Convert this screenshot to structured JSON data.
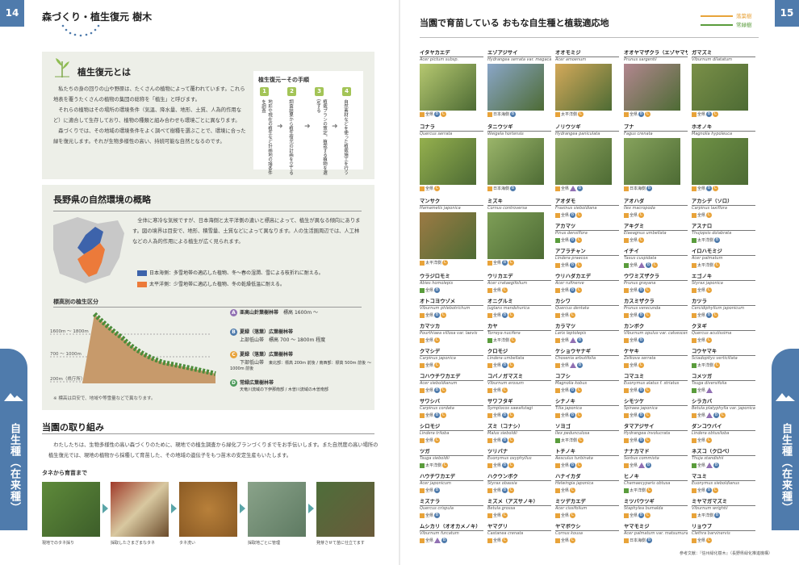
{
  "left": {
    "page_number": "14",
    "header": "森づくり・植生復元 樹木",
    "side_tab": "自生種（在来種）",
    "sec1": {
      "title": "植生復元とは",
      "paragraphs": [
        "私たちの身の回りの山や野原は、たくさんの植物によって覆われています。これら地表を覆うたくさんの植物の集団の総称を「植生」と呼びます。",
        "それらの植物はその場所の環境条件（気温、降水量、地形、土質、人為的作用など）に適合して生存しており、植物の種類と組み合わせも環境ごとに異なります。",
        "森づくりでは、その地域の環境条件をよく調べて樹種を選ぶことで、環境に合った緑を復元します。それが生物多様性の高い、持続可能な自然となるのです。"
      ],
      "steps_title": "植生復元ーその手順",
      "steps": [
        {
          "num": "1",
          "text": "地形や現在の植生など計画地の諸条件を調査"
        },
        {
          "num": "2",
          "text": "調査結果から植生復元の計画を立てる"
        },
        {
          "num": "3",
          "text": "植栽プランの策定。植栽する植物を選定する"
        },
        {
          "num": "4",
          "text": "自然素材などを使った植栽施工を行う"
        }
      ]
    },
    "sec2": {
      "title": "長野県の自然環境の概略",
      "paragraph": "全体に寒冷な気候ですが、日本海側と太平洋側の違いと標高によって、植生が異なる傾向にあります。図の境界は目安で、地形、積雪量、土質などによって異なります。人の生活圏周辺では、人工林などの人為的作用による植生が広く見られます。",
      "legend": [
        {
          "label": "日本海側：多雪地帯の適応した植物、冬〜春の湿潤、雪による枝折れに耐える。",
          "color": "#3d63ab"
        },
        {
          "label": "太平洋側：少雪地帯に適応した植物、冬の乾燥低温に耐える。",
          "color": "#ec7a3a"
        }
      ],
      "elevation_title": "標高別の植生区分",
      "elevations": [
        "1600m 〜 1800m",
        "700 〜 1000m",
        "200m（県庁所）〜 500m（高原部）"
      ],
      "zones": [
        {
          "badge": "A",
          "label": "亜高山針葉樹林帯",
          "note": "標高 1600m 〜",
          "color": "#9170b3"
        },
        {
          "badge": "B",
          "label": "夏緑（落葉）広葉樹林帯",
          "sub": "上部低山帯",
          "note": "標高 700 〜 1800m 程度",
          "color": "#4f7bac"
        },
        {
          "badge": "C",
          "label": "夏緑（落葉）広葉樹林帯",
          "sub": "下部低山帯",
          "note": "東北部：標高 200m 前後 / 南西部：標高 500m 前後",
          "note2": "〜 1000m 前後",
          "color": "#e8a33a"
        },
        {
          "badge": "D",
          "label": "常緑広葉樹林帯",
          "note": "天竜川流域の下伊那南部 / 木曽川流域の木曽南部",
          "color": "#4c9a5b"
        }
      ],
      "footnote": "※ 標高は目安で、地域や等雪量などで異なります。"
    },
    "sec3": {
      "title": "当園の取り組み",
      "paragraph": "わたしたちは、生物多様性の高い森づくりのために、現地での植生調査から緑化プランづくりまでをお手伝いします。また自然度の高い場所の植生復元では、現地の植物から採種して育苗した、その地域の遺伝子をもつ苗木の安定生産もいたします。",
      "photo_title": "タネから育苗まで",
      "photos": [
        "現地でのタネ採り",
        "採取したさまざまなタネ",
        "タネ洗い",
        "採取地ごとに管理",
        "発芽させて苗に仕立てます"
      ]
    }
  },
  "right": {
    "page_number": "15",
    "title": "当園で育苗している おもな自生種と植栽適応地",
    "side_tab": "自生種（在来種）",
    "legend": [
      {
        "label": "落葉樹",
        "color": "#e8a33a"
      },
      {
        "label": "常緑樹",
        "color": "#5a9c3c"
      }
    ],
    "footnote": "参考文献：『信州緑化樹木』（長野県緑化推進機構）",
    "species": [
      {
        "name": "イタヤカエデ",
        "latin": "Acer pictum subsp.",
        "img": "#b6c870",
        "tag": "全県",
        "c": "#e8a33a",
        "i": [
          "B",
          "C"
        ]
      },
      {
        "name": "エゾアジサイ",
        "latin": "Hydrangea serrata var. megacarpa",
        "img": "#8aa6c8",
        "tag": "日本海側",
        "c": "#e8a33a",
        "i": [
          "B"
        ]
      },
      {
        "name": "オオモミジ",
        "latin": "Acer amoenum",
        "img": "#d4a95a",
        "tag": "太平洋側",
        "c": "#e8a33a",
        "i": [
          "C"
        ]
      },
      {
        "name": "オオヤマザクラ（エゾヤマザクラ）",
        "latin": "Prunus sargentii",
        "img": "#b2868f",
        "tag": "全県",
        "c": "#e8a33a",
        "i": [
          "B",
          "C"
        ]
      },
      {
        "name": "ガマズミ",
        "latin": "Viburnum dilatatum",
        "img": "#7a8f48",
        "tag": "全県",
        "c": "#e8a33a",
        "i": [
          "B",
          "C"
        ]
      },
      {
        "name": "コナラ",
        "latin": "Quercus serrata",
        "img": "#95b04e",
        "tag": "全県",
        "c": "#e8a33a",
        "i": [
          "C"
        ]
      },
      {
        "name": "タニウツギ",
        "latin": "Weigela hortensis",
        "img": "#9bb56a",
        "tag": "日本海側",
        "c": "#e8a33a",
        "i": [
          "B"
        ]
      },
      {
        "name": "ノリウツギ",
        "latin": "Hydrangea paniculata",
        "img": "#8ea45e",
        "tag": "全県",
        "c": "#e8a33a",
        "i": [
          "A",
          "B"
        ]
      },
      {
        "name": "ブナ",
        "latin": "Fagus crenata",
        "img": "#86a25c",
        "tag": "日本海側",
        "c": "#e8a33a",
        "i": [
          "B"
        ]
      },
      {
        "name": "ホオノキ",
        "latin": "Magnolia hypoleuca",
        "img": "#6f9145",
        "tag": "全県",
        "c": "#e8a33a",
        "i": [
          "B",
          "C"
        ]
      },
      {
        "name": "マンサク",
        "latin": "Hamamelis japonica",
        "img": "#9c7a44",
        "tag": "太平洋側",
        "c": "#e8a33a",
        "i": [
          "C"
        ]
      },
      {
        "name": "ミズキ",
        "latin": "Cornus controversa",
        "img": "#7e9e57",
        "tag": "全県",
        "c": "#e8a33a",
        "i": [
          "B",
          "C"
        ]
      },
      {
        "name": "アオダモ",
        "latin": "Fraxinus sieboldiana",
        "tag": "全県",
        "c": "#e8a33a",
        "i": [
          "B",
          "C"
        ]
      },
      {
        "name": "アオハダ",
        "latin": "Ilex macropoda",
        "tag": "全県",
        "c": "#e8a33a",
        "i": [
          "C"
        ]
      },
      {
        "name": "アカシデ（ソロ）",
        "latin": "Carpinus laxiflora",
        "tag": "全県",
        "c": "#e8a33a",
        "i": [
          "C"
        ]
      },
      {
        "name": "アカマツ",
        "latin": "Pinus densiflora",
        "tag": "全県",
        "c": "#5a9c3c",
        "i": [
          "B",
          "C"
        ]
      },
      {
        "name": "アキグミ",
        "latin": "Elaeagnus umbellata",
        "tag": "全県",
        "c": "#e8a33a",
        "i": [
          "C"
        ]
      },
      {
        "name": "アスナロ",
        "latin": "Thujopsis dolabrata",
        "tag": "太平洋側",
        "c": "#5a9c3c",
        "i": [
          "B"
        ]
      },
      {
        "name": "アブラチャン",
        "latin": "Lindera praecox",
        "tag": "全県",
        "c": "#e8a33a",
        "i": [
          "B",
          "C"
        ]
      },
      {
        "name": "イチイ",
        "latin": "Taxus cuspidata",
        "tag": "全県",
        "c": "#5a9c3c",
        "i": [
          "A",
          "B",
          "C"
        ]
      },
      {
        "name": "イロハモミジ",
        "latin": "Acer palmatum",
        "tag": "太平洋側",
        "c": "#e8a33a",
        "i": [
          "C"
        ]
      },
      {
        "name": "ウラジロモミ",
        "latin": "Abies homolepis",
        "tag": "全県",
        "c": "#5a9c3c",
        "i": [
          "B"
        ]
      },
      {
        "name": "ウリカエデ",
        "latin": "Acer crataegifolium",
        "tag": "全県",
        "c": "#e8a33a",
        "i": [
          "C"
        ]
      },
      {
        "name": "ウリハダカエデ",
        "latin": "Acer rufinerve",
        "tag": "全県",
        "c": "#e8a33a",
        "i": [
          "B",
          "C"
        ]
      },
      {
        "name": "ウワミズザクラ",
        "latin": "Prunus grayana",
        "tag": "全県",
        "c": "#e8a33a",
        "i": [
          "B",
          "C"
        ]
      },
      {
        "name": "エゴノキ",
        "latin": "Styrax japonica",
        "tag": "全県",
        "c": "#e8a33a",
        "i": [
          "C"
        ]
      },
      {
        "name": "オトコヨウゾメ",
        "latin": "Viburnum phlebotrichum",
        "tag": "全県",
        "c": "#e8a33a",
        "i": [
          "B",
          "C"
        ]
      },
      {
        "name": "オニグルミ",
        "latin": "Juglans mandshurica",
        "tag": "全県",
        "c": "#e8a33a",
        "i": [
          "B",
          "C"
        ]
      },
      {
        "name": "カシワ",
        "latin": "Quercus dentata",
        "tag": "全県",
        "c": "#e8a33a",
        "i": [
          "C"
        ]
      },
      {
        "name": "カスミザクラ",
        "latin": "Prunus verecunda",
        "tag": "全県",
        "c": "#e8a33a",
        "i": [
          "B",
          "C"
        ]
      },
      {
        "name": "カツラ",
        "latin": "Cercidiphyllum japonicum",
        "tag": "全県",
        "c": "#e8a33a",
        "i": [
          "B",
          "C"
        ]
      },
      {
        "name": "カマツカ",
        "latin": "Pourthiaea villosa var. laevis",
        "tag": "全県",
        "c": "#e8a33a",
        "i": [
          "C"
        ]
      },
      {
        "name": "カヤ",
        "latin": "Torreya nucifera",
        "tag": "太平洋側",
        "c": "#5a9c3c",
        "i": [
          "C"
        ]
      },
      {
        "name": "カラマツ",
        "latin": "Larix leptolepis",
        "tag": "全県",
        "c": "#e8a33a",
        "i": [
          "A",
          "B"
        ]
      },
      {
        "name": "カンボク",
        "latin": "Viburnum opulus var. calvescens",
        "tag": "全県",
        "c": "#e8a33a",
        "i": [
          "B"
        ]
      },
      {
        "name": "クヌギ",
        "latin": "Quercus acutissima",
        "tag": "全県",
        "c": "#e8a33a",
        "i": [
          "C"
        ]
      },
      {
        "name": "クマシデ",
        "latin": "Carpinus japonica",
        "tag": "全県",
        "c": "#e8a33a",
        "i": [
          "C"
        ]
      },
      {
        "name": "クロモジ",
        "latin": "Lindera umbellata",
        "tag": "全県",
        "c": "#e8a33a",
        "i": [
          "B",
          "C"
        ]
      },
      {
        "name": "ケショウヤナギ",
        "latin": "Chosenia arbutifolia",
        "tag": "全県",
        "c": "#e8a33a",
        "i": [
          "A",
          "B"
        ]
      },
      {
        "name": "ケヤキ",
        "latin": "Zelkova serrata",
        "tag": "全県",
        "c": "#e8a33a",
        "i": [
          "C"
        ]
      },
      {
        "name": "コウヤマキ",
        "latin": "Sciadopitys verticillata",
        "tag": "太平洋側",
        "c": "#5a9c3c",
        "i": [
          "C"
        ]
      },
      {
        "name": "コハウチワカエデ",
        "latin": "Acer sieboldianum",
        "tag": "全県",
        "c": "#e8a33a",
        "i": [
          "B",
          "C"
        ]
      },
      {
        "name": "コバノガマズミ",
        "latin": "Viburnum erosum",
        "tag": "全県",
        "c": "#e8a33a",
        "i": [
          "C"
        ]
      },
      {
        "name": "コブシ",
        "latin": "Magnolia kobus",
        "tag": "全県",
        "c": "#e8a33a",
        "i": [
          "B",
          "C"
        ]
      },
      {
        "name": "コマユミ",
        "latin": "Euonymus alatus f. striatus",
        "tag": "全県",
        "c": "#e8a33a",
        "i": [
          "B",
          "C"
        ]
      },
      {
        "name": "コメツガ",
        "latin": "Tsuga diversifolia",
        "tag": "全県",
        "c": "#5a9c3c",
        "i": [
          "A"
        ]
      },
      {
        "name": "サワシバ",
        "latin": "Carpinus cordata",
        "tag": "全県",
        "c": "#e8a33a",
        "i": [
          "B",
          "C"
        ]
      },
      {
        "name": "サワフタギ",
        "latin": "Symplocos sawafutagi",
        "tag": "全県",
        "c": "#e8a33a",
        "i": [
          "B",
          "C"
        ]
      },
      {
        "name": "シナノキ",
        "latin": "Tilia japonica",
        "tag": "全県",
        "c": "#e8a33a",
        "i": [
          "B",
          "C"
        ]
      },
      {
        "name": "シモツケ",
        "latin": "Spiraea japonica",
        "tag": "全県",
        "c": "#e8a33a",
        "i": [
          "B",
          "C"
        ]
      },
      {
        "name": "シラカバ",
        "latin": "Betula platyphylla var. japonica",
        "tag": "全県",
        "c": "#e8a33a",
        "i": [
          "A",
          "B",
          "C"
        ]
      },
      {
        "name": "シロモジ",
        "latin": "Lindera triloba",
        "tag": "全県",
        "c": "#e8a33a",
        "i": [
          "C"
        ]
      },
      {
        "name": "ズミ（コナシ）",
        "latin": "Malus sieboldii",
        "tag": "全県",
        "c": "#e8a33a",
        "i": [
          "B",
          "C"
        ]
      },
      {
        "name": "ソヨゴ",
        "latin": "Ilex pedunculosa",
        "tag": "太平洋側",
        "c": "#5a9c3c",
        "i": [
          "C"
        ]
      },
      {
        "name": "タマアジサイ",
        "latin": "Hydrangea involucrata",
        "tag": "全県",
        "c": "#e8a33a",
        "i": [
          "B",
          "C"
        ]
      },
      {
        "name": "ダンコウバイ",
        "latin": "Lindera obtusiloba",
        "tag": "全県",
        "c": "#e8a33a",
        "i": [
          "C"
        ]
      },
      {
        "name": "ツガ",
        "latin": "Tsuga sieboldii",
        "tag": "太平洋側",
        "c": "#5a9c3c",
        "i": [
          "C"
        ]
      },
      {
        "name": "ツリバナ",
        "latin": "Euonymus oxyphyllus",
        "tag": "全県",
        "c": "#e8a33a",
        "i": [
          "B",
          "C"
        ]
      },
      {
        "name": "トチノキ",
        "latin": "Aesculus turbinata",
        "tag": "全県",
        "c": "#e8a33a",
        "i": [
          "B",
          "C"
        ]
      },
      {
        "name": "ナナカマド",
        "latin": "Sorbus commixta",
        "tag": "全県",
        "c": "#e8a33a",
        "i": [
          "A",
          "B"
        ]
      },
      {
        "name": "ネズコ（クロベ）",
        "latin": "Thuja standishii",
        "tag": "全県",
        "c": "#5a9c3c",
        "i": [
          "A",
          "B"
        ]
      },
      {
        "name": "ハウチワカエデ",
        "latin": "Acer japonicum",
        "tag": "全県",
        "c": "#e8a33a",
        "i": [
          "B"
        ]
      },
      {
        "name": "ハクウンボク",
        "latin": "Styrax obassia",
        "tag": "全県",
        "c": "#e8a33a",
        "i": [
          "B",
          "C"
        ]
      },
      {
        "name": "ハナイカダ",
        "latin": "Helwingia japonica",
        "tag": "全県",
        "c": "#e8a33a",
        "i": [
          "C"
        ]
      },
      {
        "name": "ヒノキ",
        "latin": "Chamaecyparis obtusa",
        "tag": "太平洋側",
        "c": "#5a9c3c",
        "i": [
          "C"
        ]
      },
      {
        "name": "マユミ",
        "latin": "Euonymus sieboldianus",
        "tag": "全県",
        "c": "#e8a33a",
        "i": [
          "B",
          "C"
        ]
      },
      {
        "name": "ミズナラ",
        "latin": "Quercus crispula",
        "tag": "全県",
        "c": "#e8a33a",
        "i": [
          "B"
        ]
      },
      {
        "name": "ミズメ（アズサノキ）",
        "latin": "Betula grossa",
        "tag": "全県",
        "c": "#e8a33a",
        "i": [
          "C"
        ]
      },
      {
        "name": "ミツデカエデ",
        "latin": "Acer cissifolium",
        "tag": "全県",
        "c": "#e8a33a",
        "i": [
          "C"
        ]
      },
      {
        "name": "ミツバウツギ",
        "latin": "Staphylea bumalda",
        "tag": "全県",
        "c": "#e8a33a",
        "i": [
          "B",
          "C"
        ]
      },
      {
        "name": "ミヤマガマズミ",
        "latin": "Viburnum wrightii",
        "tag": "太平洋側",
        "c": "#e8a33a",
        "i": [
          "B"
        ]
      },
      {
        "name": "ムシカリ（オオカメノキ）",
        "latin": "Viburnum furcatum",
        "tag": "全県",
        "c": "#e8a33a",
        "i": [
          "A",
          "B"
        ]
      },
      {
        "name": "ヤマグリ",
        "latin": "Castanea crenata",
        "tag": "全県",
        "c": "#e8a33a",
        "i": [
          "C"
        ]
      },
      {
        "name": "ヤマボウシ",
        "latin": "Cornus kousa",
        "tag": "全県",
        "c": "#e8a33a",
        "i": [
          "C"
        ]
      },
      {
        "name": "ヤマモミジ",
        "latin": "Acer palmatum var. matsumurae",
        "tag": "日本海側",
        "c": "#e8a33a",
        "i": [
          "B"
        ]
      },
      {
        "name": "リョウブ",
        "latin": "Clethra barvinervis",
        "tag": "全県",
        "c": "#e8a33a",
        "i": [
          "C"
        ]
      }
    ]
  }
}
